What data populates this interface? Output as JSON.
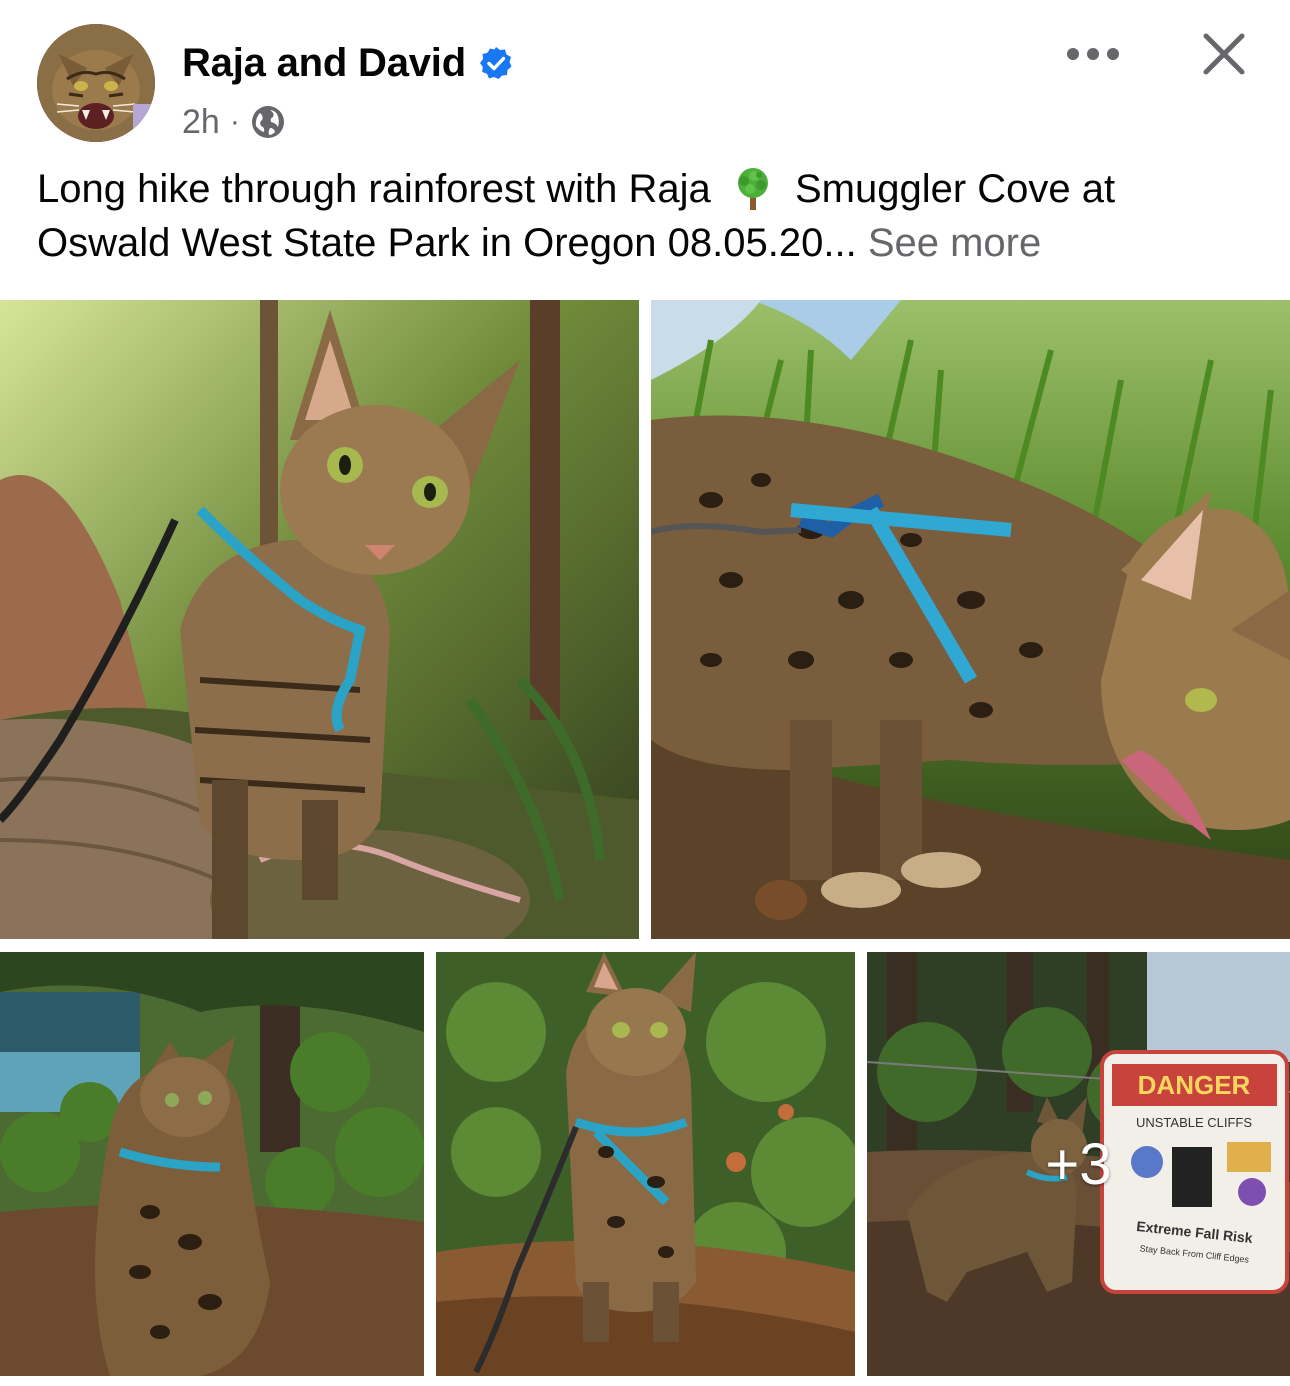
{
  "post": {
    "author": "Raja and David",
    "timestamp": "2h",
    "separator": "·",
    "privacy_icon": "globe-icon",
    "verified_icon": "verified-badge-icon",
    "caption_part1": "Long hike through rainforest with Raja ",
    "caption_emoji": "tree-emoji",
    "caption_part2": " Smuggler Cove at Oswald West State Park in Oregon 08.05.20...",
    "see_more": "See more",
    "more_icon": "ellipsis-icon",
    "close_icon": "close-icon"
  },
  "photos": {
    "items": [
      {
        "subject": "cat-on-log-photo"
      },
      {
        "subject": "cat-eating-grass-photo"
      },
      {
        "subject": "cat-sitting-by-water-photo"
      },
      {
        "subject": "cat-standing-in-shrubs-photo"
      },
      {
        "subject": "cat-by-danger-sign-photo"
      }
    ],
    "more_count": "+3",
    "sign_texts": {
      "danger": "DANGER",
      "unstable": "UNSTABLE CLIFFS",
      "fall_risk": "Extreme Fall Risk",
      "stay_back": "Stay Back From Cliff Edges"
    }
  },
  "colors": {
    "verified_blue": "#1877f2",
    "muted_text": "#65676b",
    "primary_text": "#050505"
  }
}
